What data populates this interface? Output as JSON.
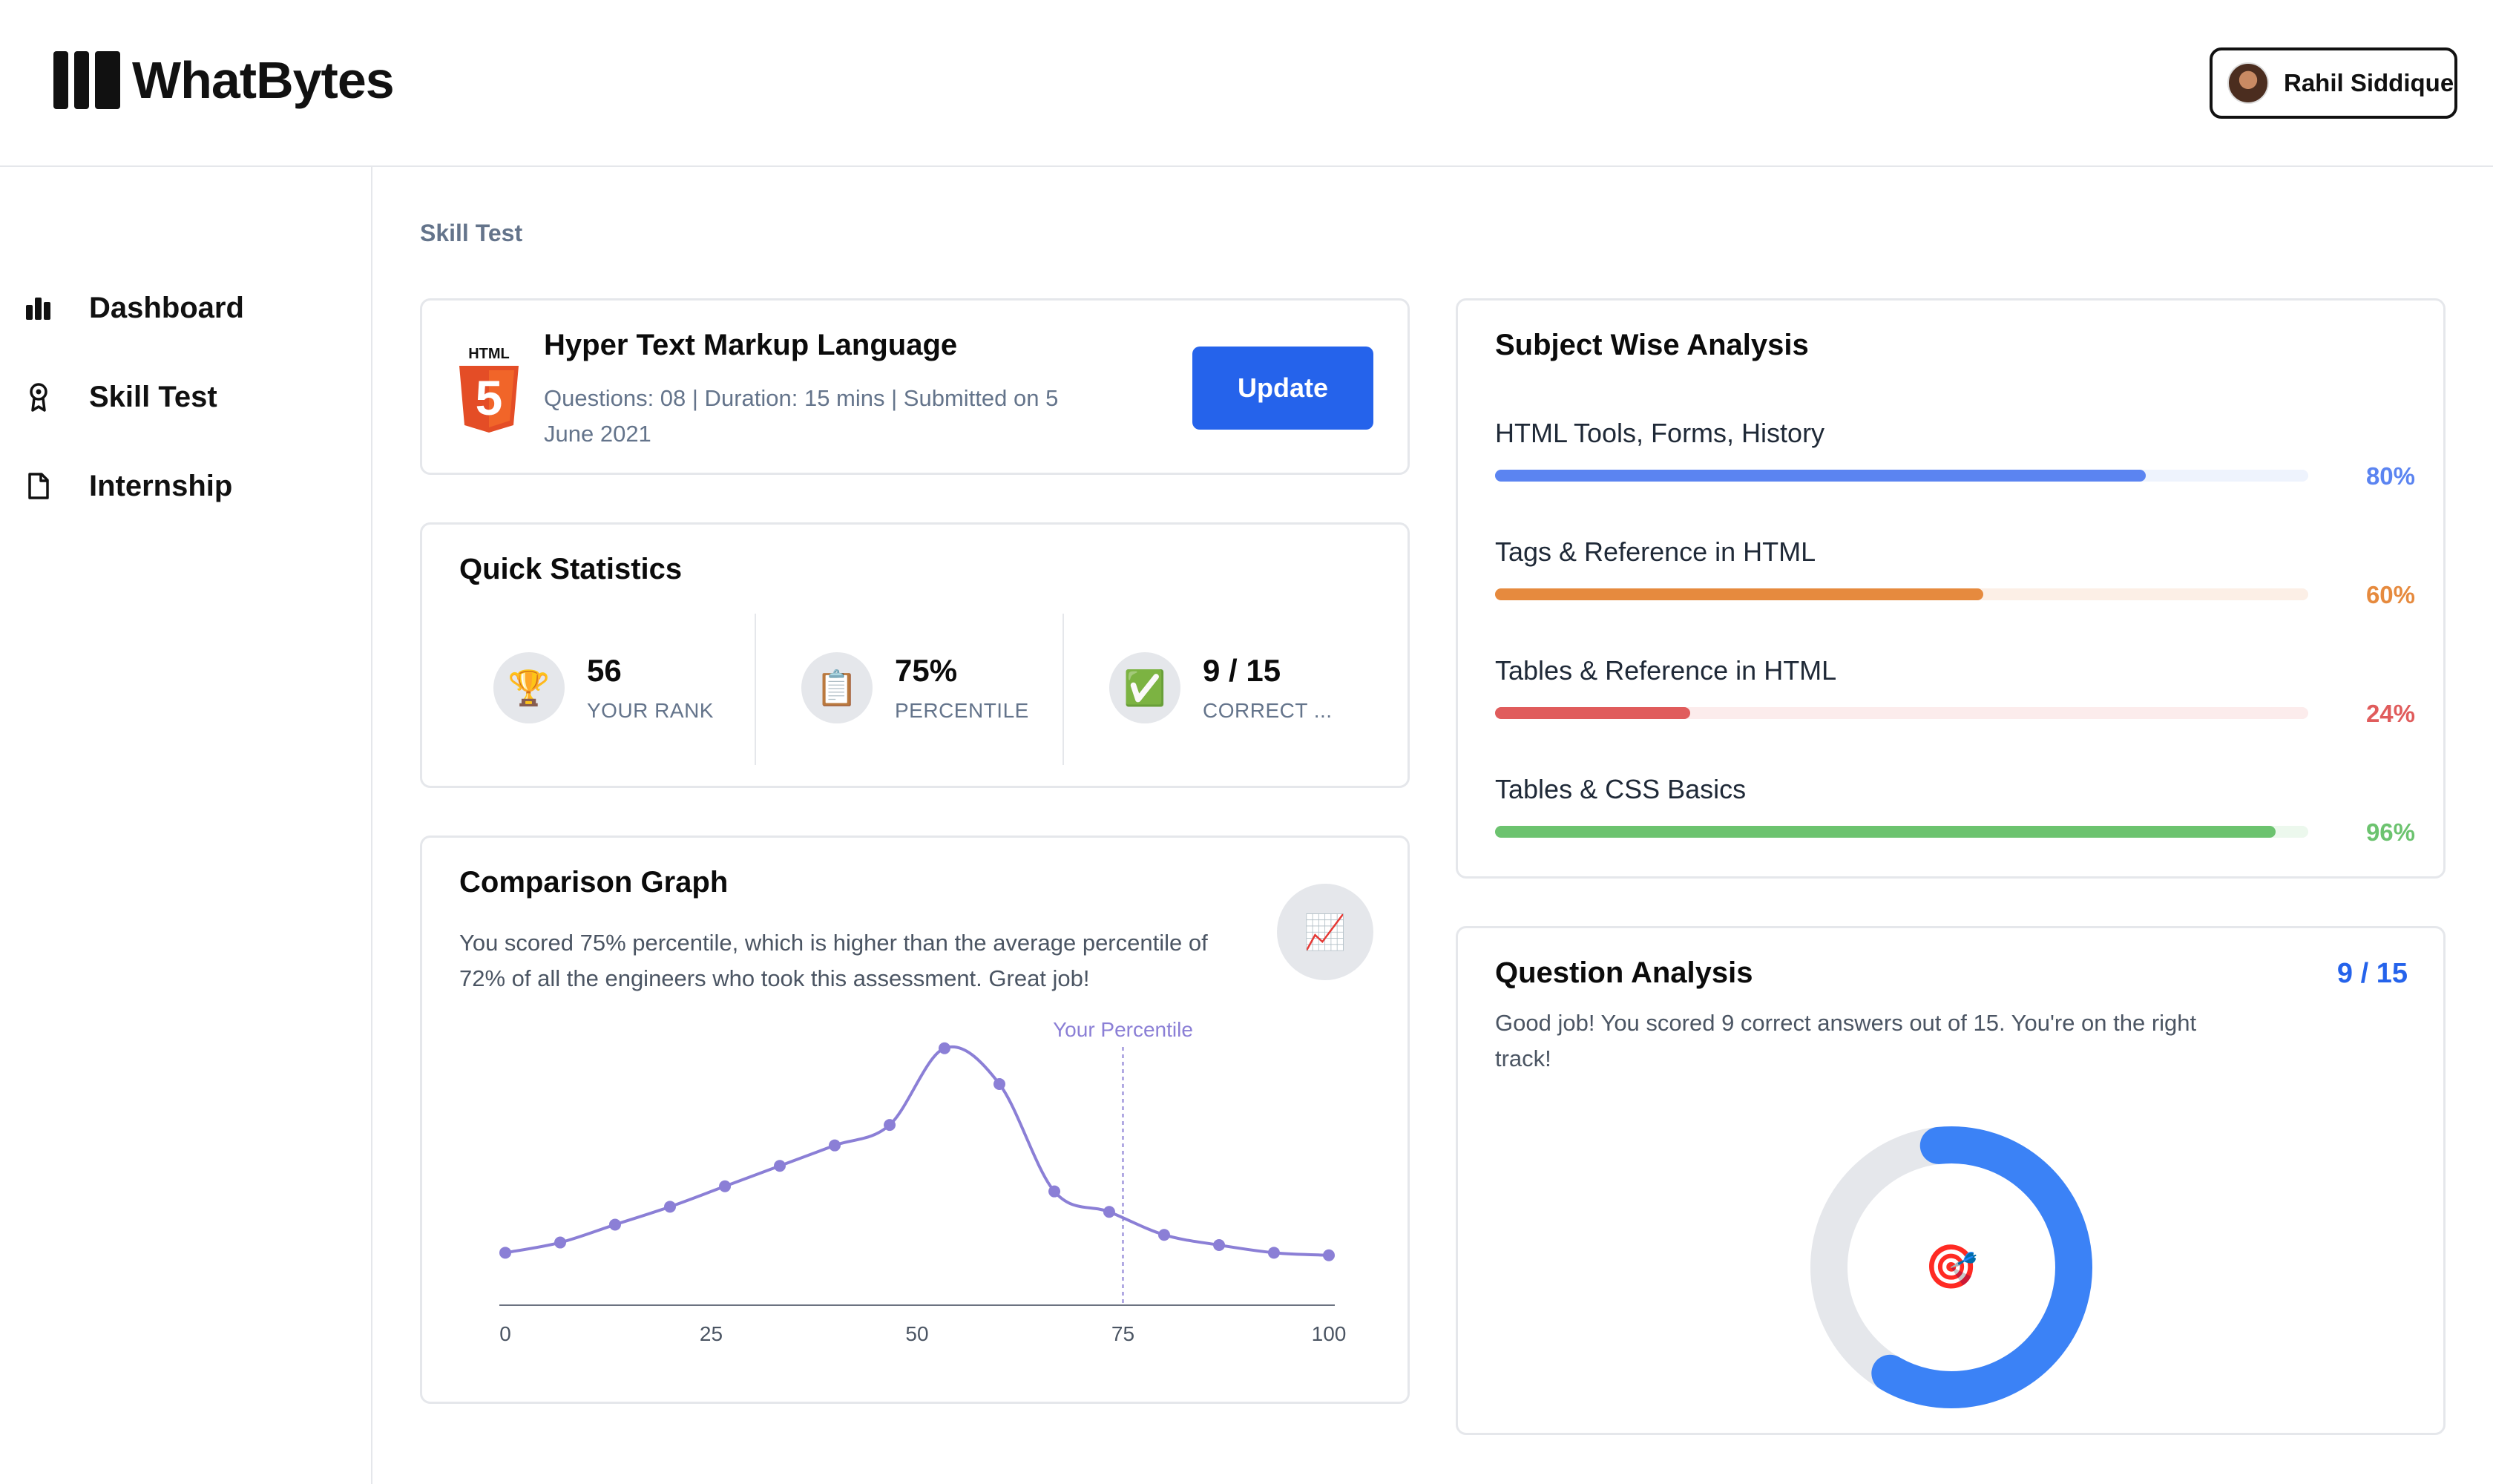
{
  "app": {
    "name": "WhatBytes",
    "user_name": "Rahil Siddique"
  },
  "sidebar": {
    "items": [
      {
        "label": "Dashboard",
        "icon": "bar-chart-icon"
      },
      {
        "label": "Skill Test",
        "icon": "award-icon"
      },
      {
        "label": "Internship",
        "icon": "file-icon"
      }
    ]
  },
  "breadcrumb": "Skill Test",
  "test": {
    "logo_text": "HTML",
    "logo_number": "5",
    "title": "Hyper Text Markup Language",
    "meta": "Questions: 08 |  Duration: 15 mins |  Submitted on 5 June 2021",
    "update_label": "Update"
  },
  "quick_stats": {
    "title": "Quick Statistics",
    "items": [
      {
        "icon": "trophy-icon",
        "glyph": "🏆",
        "value": "56",
        "label": "YOUR RANK"
      },
      {
        "icon": "clipboard-icon",
        "glyph": "📋",
        "value": "75%",
        "label": "PERCENTILE"
      },
      {
        "icon": "check-icon",
        "glyph": "✅",
        "value": "9 / 15",
        "label": "CORRECT ..."
      }
    ]
  },
  "comparison": {
    "title": "Comparison Graph",
    "description": "You scored 75% percentile, which is higher than the average percentile of 72% of all the engineers who took this assessment. Great job!",
    "badge_glyph": "📈",
    "marker_label": "Your Percentile",
    "accent": "#8b7fd6"
  },
  "chart_data": {
    "type": "line",
    "x": [
      0,
      6.67,
      13.33,
      20,
      26.67,
      33.33,
      40,
      46.67,
      53.33,
      60,
      66.67,
      73.33,
      80,
      86.67,
      93.33,
      100
    ],
    "values": [
      6,
      10,
      17,
      24,
      32,
      40,
      48,
      56,
      86,
      72,
      30,
      22,
      13,
      9,
      6,
      5
    ],
    "ylim": [
      0,
      90
    ],
    "xlim": [
      0,
      100
    ],
    "xticks": [
      "0",
      "25",
      "50",
      "75",
      "100"
    ],
    "xtick_values": [
      0,
      25,
      50,
      75,
      100
    ],
    "marker_x": 75,
    "xlabel": "",
    "ylabel": ""
  },
  "subjects": {
    "title": "Subject Wise Analysis",
    "items": [
      {
        "name": "HTML Tools, Forms, History",
        "percent_label": "80%",
        "value": 0.8,
        "color": "#5b84f1",
        "track": "#eef3fd"
      },
      {
        "name": "Tags & Reference in HTML",
        "percent_label": "60%",
        "value": 0.6,
        "color": "#e68a3e",
        "track": "#fcefe6"
      },
      {
        "name": "Tables & Reference in HTML",
        "percent_label": "24%",
        "value": 0.24,
        "color": "#e05c5c",
        "track": "#fcecec"
      },
      {
        "name": "Tables & CSS Basics",
        "percent_label": "96%",
        "value": 0.96,
        "color": "#6cc36f",
        "track": "#ecf8ed"
      }
    ]
  },
  "question_analysis": {
    "title": "Question Analysis",
    "score": "9 / 15",
    "description": "Good job! You scored 9 correct answers out of 15. You're on the right track!",
    "correct": 9,
    "total": 15,
    "center_glyph": "🎯",
    "ring_color": "#3b82f6",
    "ring_track": "#e5e7eb"
  }
}
